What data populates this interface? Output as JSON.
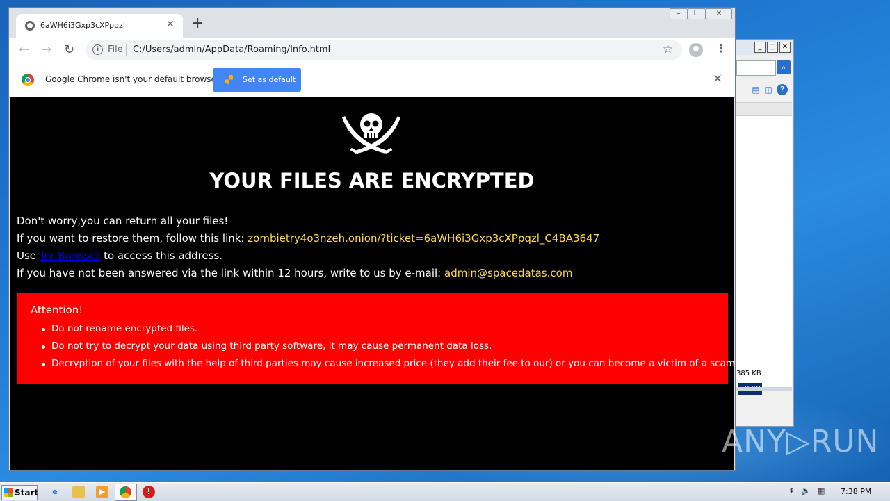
{
  "browser": {
    "tab_title": "6aWH6i3Gxp3cXPpqzl",
    "tab_close": "✕",
    "new_tab": "+",
    "file_label": "File",
    "url": "C:/Users/admin/AppData/Roaming/Info.html",
    "infobar_text": "Google Chrome isn't your default browser",
    "set_default_label": "Set as default"
  },
  "page": {
    "headline": "YOUR FILES ARE ENCRYPTED",
    "line1": "Don't worry,you can return all your files!",
    "line2_prefix": "If you want to restore them, follow this link: ",
    "line2_link": "zombietry4o3nzeh.onion/?ticket=6aWH6i3Gxp3cXPpqzl_C4BA3647",
    "line3_prefix": "Use ",
    "line3_link": "Tor Browser",
    "line3_suffix": " to access this address.",
    "line4_prefix": "If you have not been answered via the link within 12 hours, write to us by e-mail: ",
    "line4_email": "admin@spacedatas.com",
    "attention_title": "Attention!",
    "attention_items": [
      "Do not rename encrypted files.",
      "Do not try to decrypt your data using third party software, it may cause permanent data loss.",
      "Decryption of your files with the help of third parties may cause increased price (they add their fee to our) or you can become a victim of a scam."
    ]
  },
  "background_window": {
    "size_1": "385 KB",
    "size_2": "8 KB"
  },
  "taskbar": {
    "start_label": "Start",
    "clock": "7:38 PM"
  },
  "watermark": "ANY▷RUN",
  "colors": {
    "link_yellow": "#ffd84a",
    "attention_red": "#ff0000",
    "set_default_blue": "#4285f4"
  }
}
